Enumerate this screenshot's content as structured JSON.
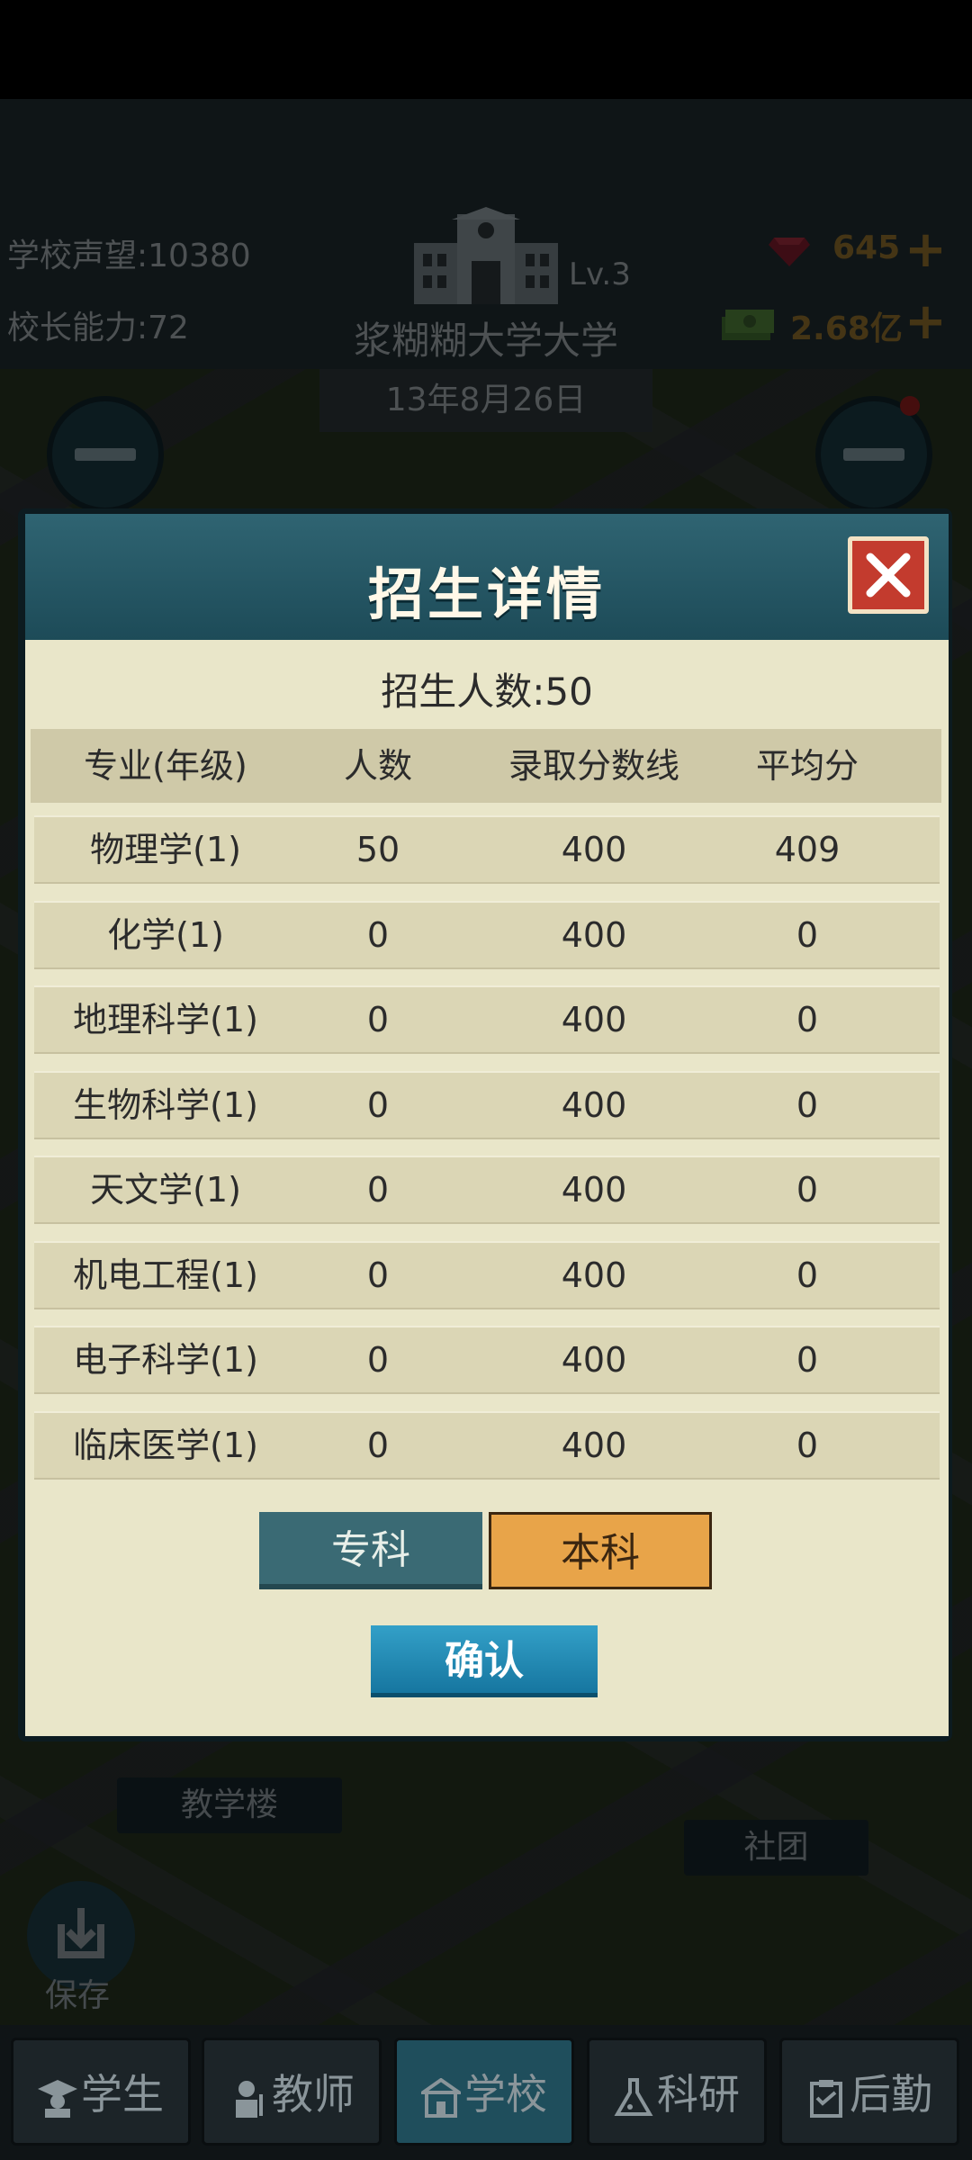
{
  "header": {
    "reputation_label": "学校声望:",
    "reputation_value": "10380",
    "ability_label": "校长能力:",
    "ability_value": "72",
    "level": "Lv.3",
    "school_name": "浆糊糊大学大学",
    "date": "13年8月26日",
    "gems": "645",
    "money": "2.68亿",
    "icons": [
      "school-building-icon",
      "gem-icon",
      "cash-icon",
      "plus-icon",
      "minus-icon"
    ]
  },
  "modal": {
    "title": "招生详情",
    "enroll_label": "招生人数:",
    "enroll_value": "50",
    "columns": [
      "专业(年级)",
      "人数",
      "录取分数线",
      "平均分"
    ],
    "rows": [
      [
        "物理学(1)",
        "50",
        "400",
        "409"
      ],
      [
        "化学(1)",
        "0",
        "400",
        "0"
      ],
      [
        "地理科学(1)",
        "0",
        "400",
        "0"
      ],
      [
        "生物科学(1)",
        "0",
        "400",
        "0"
      ],
      [
        "天文学(1)",
        "0",
        "400",
        "0"
      ],
      [
        "机电工程(1)",
        "0",
        "400",
        "0"
      ],
      [
        "电子科学(1)",
        "0",
        "400",
        "0"
      ],
      [
        "临床医学(1)",
        "0",
        "400",
        "0"
      ]
    ],
    "btn_zhuanke": "专科",
    "btn_benke": "本科",
    "btn_confirm": "确认"
  },
  "map": {
    "label_teaching": "教学楼",
    "label_club": "社团",
    "save_label": "保存"
  },
  "nav": {
    "items": [
      "学生",
      "教师",
      "学校",
      "科研",
      "后勤"
    ],
    "active": "学校"
  },
  "colors": {
    "modal_header": "#2f6472",
    "modal_body": "#e9e6c9",
    "row_bg": "#dbd6b5",
    "benke_btn": "#e8a449",
    "zhuanke_btn": "#3a6a74",
    "confirm_btn": "#1676a0",
    "close_btn": "#c33b2e"
  }
}
